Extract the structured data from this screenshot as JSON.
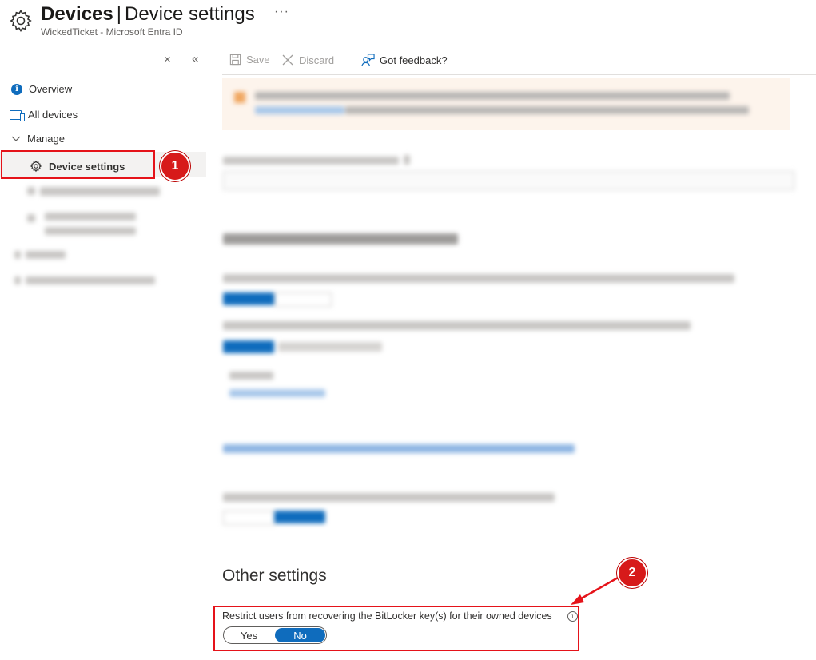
{
  "header": {
    "title_bold": "Devices",
    "separator": "|",
    "title_rest": "Device settings",
    "more": "···",
    "breadcrumb": "WickedTicket - Microsoft Entra ID"
  },
  "sidebar": {
    "close": "×",
    "collapse": "«",
    "items": [
      {
        "label": "Overview",
        "icon": "info-icon"
      },
      {
        "label": "All devices",
        "icon": "devices-icon"
      },
      {
        "label": "Manage",
        "icon": "chevron-down-icon"
      },
      {
        "label": "Device settings",
        "icon": "gear-icon"
      }
    ]
  },
  "toolbar": {
    "save_label": "Save",
    "discard_label": "Discard",
    "feedback_label": "Got feedback?"
  },
  "main": {
    "other_settings_heading": "Other settings",
    "bitlocker_label": "Restrict users from recovering the BitLocker key(s) for their owned devices",
    "info_glyph": "i",
    "toggle": {
      "options": [
        "Yes",
        "No"
      ],
      "selected": "No"
    }
  },
  "annotations": {
    "badge1": "1",
    "badge2": "2"
  },
  "colors": {
    "accent": "#0f6cbd",
    "highlight_border": "#e5131a",
    "badge": "#d71a1a",
    "banner_bg": "#fdf4ec"
  }
}
